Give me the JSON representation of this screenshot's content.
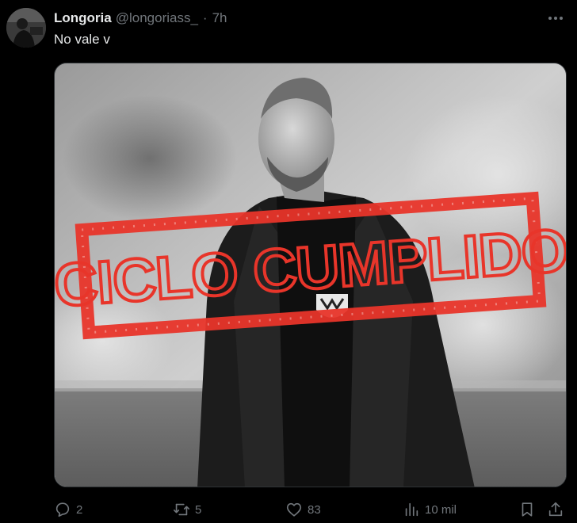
{
  "tweet": {
    "author_name": "Longoria",
    "handle": "@longoriass_",
    "separator": "·",
    "time": "7h",
    "text": "No vale v",
    "image": {
      "stamp_text": "CICLO CUMPLIDO",
      "stamp_color": "#e8352a"
    }
  },
  "actions": {
    "replies": "2",
    "reposts": "5",
    "likes": "83",
    "views": "10 mil"
  },
  "colors": {
    "background": "#000000",
    "text_primary": "#e7e9ea",
    "text_secondary": "#71767b",
    "border": "#2f3336"
  },
  "icons": [
    "more-icon",
    "reply-icon",
    "repost-icon",
    "like-icon",
    "views-icon",
    "bookmark-icon",
    "share-icon"
  ]
}
